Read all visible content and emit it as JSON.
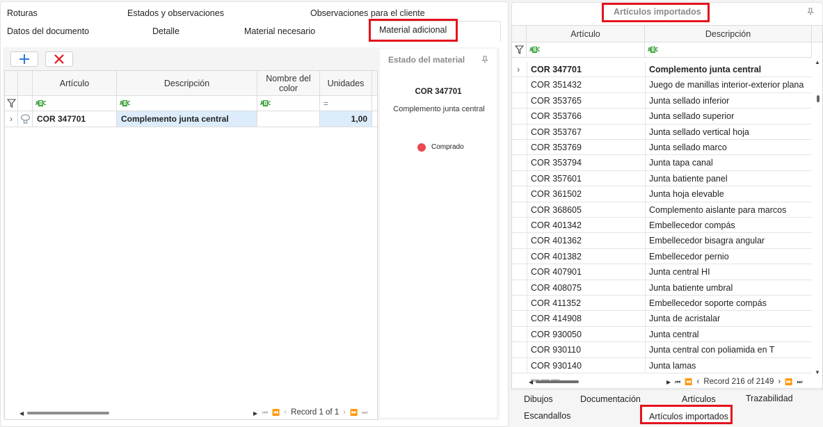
{
  "left_tabs": {
    "row1": [
      "Roturas",
      "Estados y observaciones",
      "Observaciones para el cliente"
    ],
    "row2": [
      "Datos del documento",
      "Detalle",
      "Material necesario",
      "Material adicional"
    ]
  },
  "toolbar": {
    "add_icon": "plus-icon",
    "delete_icon": "x-icon"
  },
  "left_grid": {
    "headers": [
      "Artículo",
      "Descripción",
      "Nombre del color",
      "Unidades"
    ],
    "filter_marker": "ABC",
    "filter_eq": "=",
    "rows": [
      {
        "articulo": "COR 347701",
        "descripcion": "Complemento junta central",
        "color": "",
        "unidades": "1,00"
      }
    ],
    "pager_text": "Record 1 of 1"
  },
  "state_panel": {
    "title": "Estado del material",
    "code": "COR 347701",
    "description": "Complemento junta central",
    "legend_label": "Comprado",
    "legend_color": "#e84a4f"
  },
  "right_panel": {
    "title": "Artículos importados",
    "headers": [
      "Artículo",
      "Descripción"
    ],
    "filter_marker": "ABC",
    "rows": [
      {
        "articulo": "COR 347701",
        "descripcion": "Complemento junta central"
      },
      {
        "articulo": "COR 351432",
        "descripcion": "Juego de manillas interior-exterior plana"
      },
      {
        "articulo": "COR 353765",
        "descripcion": "Junta sellado inferior"
      },
      {
        "articulo": "COR 353766",
        "descripcion": "Junta sellado superior"
      },
      {
        "articulo": "COR 353767",
        "descripcion": "Junta sellado vertical hoja"
      },
      {
        "articulo": "COR 353769",
        "descripcion": "Junta sellado marco"
      },
      {
        "articulo": "COR 353794",
        "descripcion": "Junta tapa canal"
      },
      {
        "articulo": "COR 357601",
        "descripcion": "Junta batiente panel"
      },
      {
        "articulo": "COR 361502",
        "descripcion": "Junta hoja elevable"
      },
      {
        "articulo": "COR 368605",
        "descripcion": "Complemento aislante para marcos"
      },
      {
        "articulo": "COR 401342",
        "descripcion": "Embellecedor compás"
      },
      {
        "articulo": "COR 401362",
        "descripcion": "Embellecedor bisagra angular"
      },
      {
        "articulo": "COR 401382",
        "descripcion": "Embellecedor pernio"
      },
      {
        "articulo": "COR 407901",
        "descripcion": "Junta central HI"
      },
      {
        "articulo": "COR 408075",
        "descripcion": "Junta batiente umbral"
      },
      {
        "articulo": "COR 411352",
        "descripcion": "Embellecedor soporte compás"
      },
      {
        "articulo": "COR 414908",
        "descripcion": "Junta de acristalar"
      },
      {
        "articulo": "COR 930050",
        "descripcion": "Junta central"
      },
      {
        "articulo": "COR 930110",
        "descripcion": "Junta central con poliamida en T"
      },
      {
        "articulo": "COR 930140",
        "descripcion": "Junta lamas"
      }
    ],
    "pager_text": "Record 216 of 2149",
    "bottom_tabs_row1": [
      "Dibujos",
      "Documentación",
      "Artículos",
      "Trazabilidad"
    ],
    "bottom_tabs_row2": [
      "Escandallos",
      "Artículos importados"
    ]
  },
  "colors": {
    "highlight_red": "#e3131d",
    "selected_cell": "#dcecfb",
    "accent_blue": "#2a7bd4"
  }
}
